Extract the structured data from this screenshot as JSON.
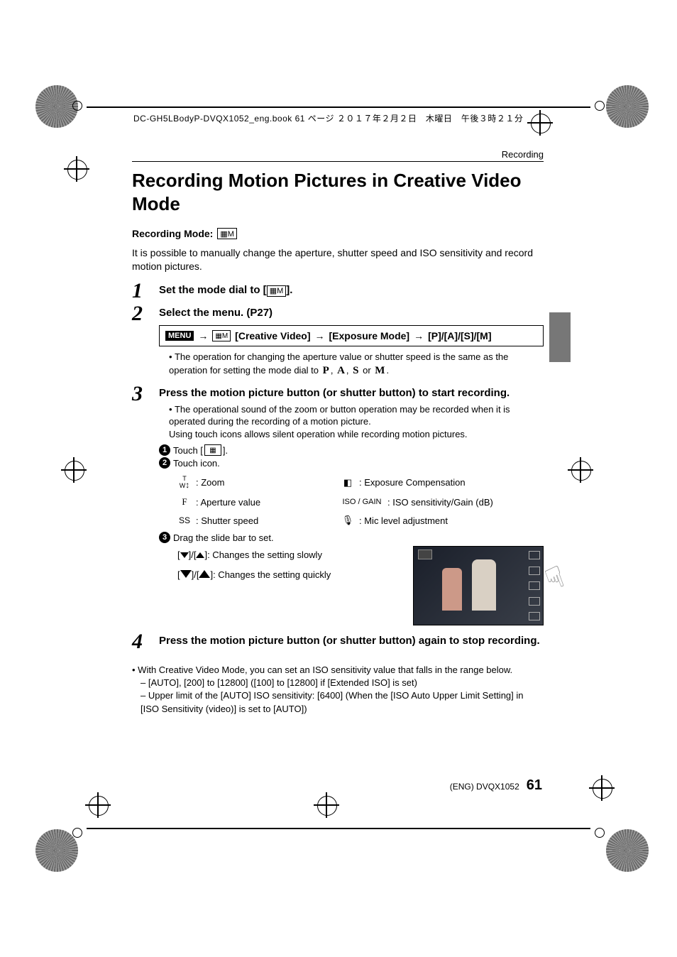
{
  "book_header": "DC-GH5LBodyP-DVQX1052_eng.book  61 ページ  ２０１７年２月２日　木曜日　午後３時２１分",
  "section_label": "Recording",
  "title": "Recording Motion Pictures in Creative Video Mode",
  "recording_mode_label": "Recording Mode:",
  "recording_mode_icon": "▦M",
  "intro": "It is possible to manually change the aperture, shutter speed and ISO sensitivity and record motion pictures.",
  "steps": {
    "s1_num": "1",
    "s1_head_a": "Set the mode dial to [",
    "s1_head_icon": "▦M",
    "s1_head_b": "].",
    "s2_num": "2",
    "s2_head": "Select the menu. (P27)",
    "menu_chip": "MENU",
    "menu_icon": "▦M",
    "menu_path_a": "[Creative Video]",
    "menu_path_b": "[Exposure Mode]",
    "menu_path_c": "[P]/[A]/[S]/[M]",
    "s2_bullet": "The operation for changing the aperture value or shutter speed is the same as the operation for setting the mode dial to",
    "s2_mode_p": "P",
    "s2_mode_a": "A",
    "s2_mode_s": "S",
    "s2_mode_m": "M",
    "s3_num": "3",
    "s3_head": "Press the motion picture button (or shutter button) to start recording.",
    "s3_bullet_a": "The operational sound of the zoom or button operation may be recorded when it is operated during the recording of a motion picture.",
    "s3_bullet_b": "Using touch icons allows silent operation while recording motion pictures.",
    "touch_c1_num": "1",
    "touch_c1_a": "Touch [",
    "touch_c1_icon": "▦",
    "touch_c1_b": "].",
    "touch_c2_num": "2",
    "touch_c2": "Touch icon.",
    "icon_zoom_sym": "T\nW↕",
    "icon_zoom": ": Zoom",
    "icon_exp_sym": "☀±",
    "icon_exp": ": Exposure Compensation",
    "icon_f_sym": "F",
    "icon_f": ": Aperture value",
    "icon_iso_sym": "ISO / GAIN",
    "icon_iso": ": ISO sensitivity/Gain (dB)",
    "icon_ss_sym": "SS",
    "icon_ss": ": Shutter speed",
    "icon_mic_sym": "🎤",
    "icon_mic": ": Mic level adjustment",
    "touch_c3_num": "3",
    "touch_c3": "Drag the slide bar to set.",
    "slide_slow": "]: Changes the setting slowly",
    "slide_fast": "]: Changes the setting quickly",
    "s4_num": "4",
    "s4_head": "Press the motion picture button (or shutter button) again to stop recording."
  },
  "post": {
    "p1": "With Creative Video Mode, you can set an ISO sensitivity value that falls in the range below.",
    "d1": "[AUTO], [200] to [12800] ([100] to [12800] if [Extended ISO] is set)",
    "d2": "Upper limit of the [AUTO] ISO sensitivity: [6400] (When the [ISO Auto Upper Limit Setting] in [ISO Sensitivity (video)] is set to [AUTO])"
  },
  "footer_code": "(ENG) DVQX1052",
  "page_number": "61"
}
